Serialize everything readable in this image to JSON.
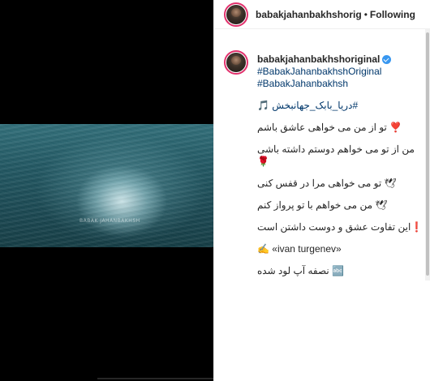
{
  "media": {
    "watermark": "BABAK JAHANBAKHSH"
  },
  "header": {
    "username": "babakjahanbakhshorig",
    "separator": "•",
    "follow_status": "Following"
  },
  "caption": {
    "author": "babakjahanbakhshoriginal",
    "verified": true,
    "hashtags": [
      "#BabakJahanbakhshOriginal",
      "#BabakJahanbakhsh"
    ],
    "lines": [
      "#دریا_بابک_جهانبخش 🎵",
      "❣️ تو از من می خواهی عاشق باشم",
      "من از تو می خواهم دوستم داشته باشی",
      "🌹",
      "🕊 تو می خواهی مرا در قفس کنی",
      "🕊 من می خواهم با تو پرواز کنم",
      "❗️این تفاوت عشق و دوست داشتن است",
      "✍️ «ivan turgenev»",
      "🔤 نصفه آپ لود شده"
    ]
  },
  "colors": {
    "link": "#00376b",
    "verified": "#3897f0",
    "story_ring": "#e1306c",
    "media_bg": "#000000"
  },
  "icons": [
    "music-note-icon",
    "verified-badge-icon"
  ]
}
